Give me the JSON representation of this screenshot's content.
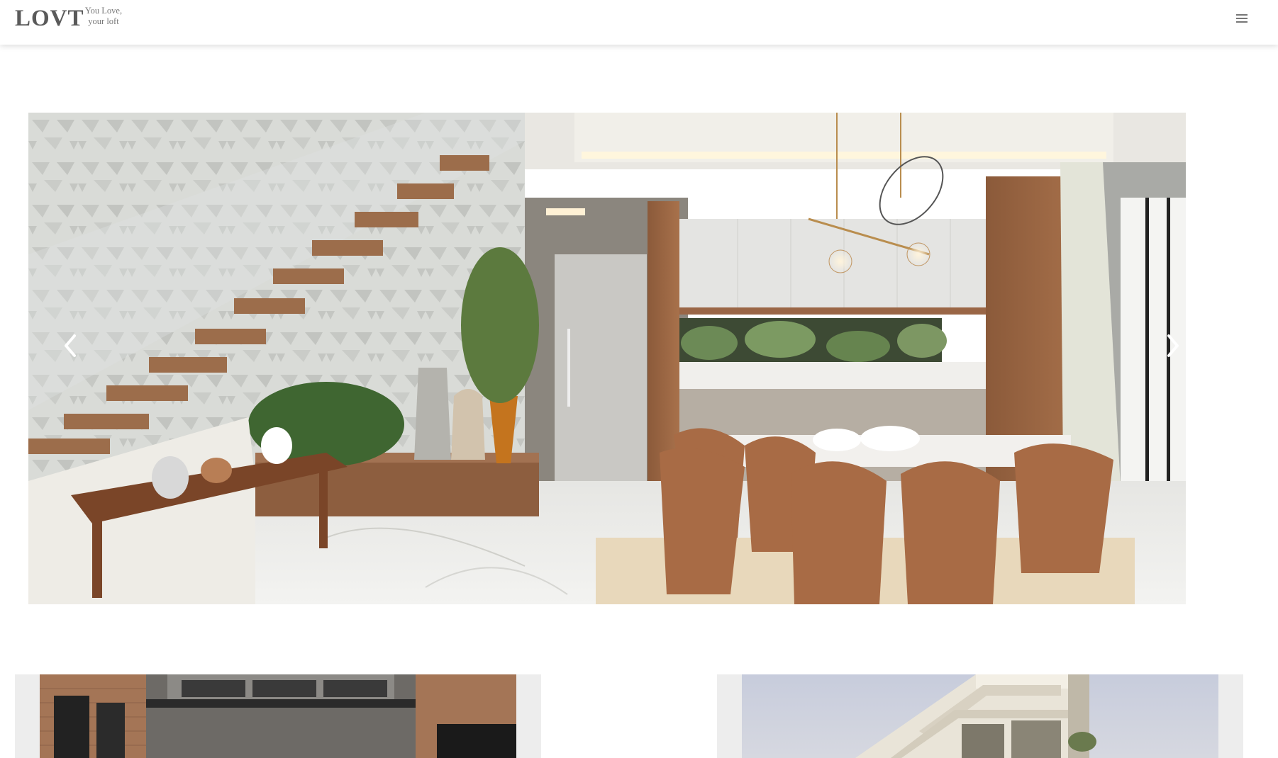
{
  "header": {
    "logo": "LOVT",
    "tagline_line1": "You Love,",
    "tagline_line2": "your loft",
    "menu_icon": "hamburger-icon"
  },
  "carousel": {
    "image_subject": "interior-living-dining-render",
    "prev_icon": "chevron-left-icon",
    "next_icon": "chevron-right-icon"
  },
  "projects": [
    {
      "image_subject": "apartment-interior-photo"
    },
    {
      "image_subject": "building-exterior-photo"
    }
  ],
  "colors": {
    "logo": "#5a5a5a",
    "tagline": "#7a7a7a",
    "menu_icon": "#777777",
    "card_background": "#ededed"
  }
}
